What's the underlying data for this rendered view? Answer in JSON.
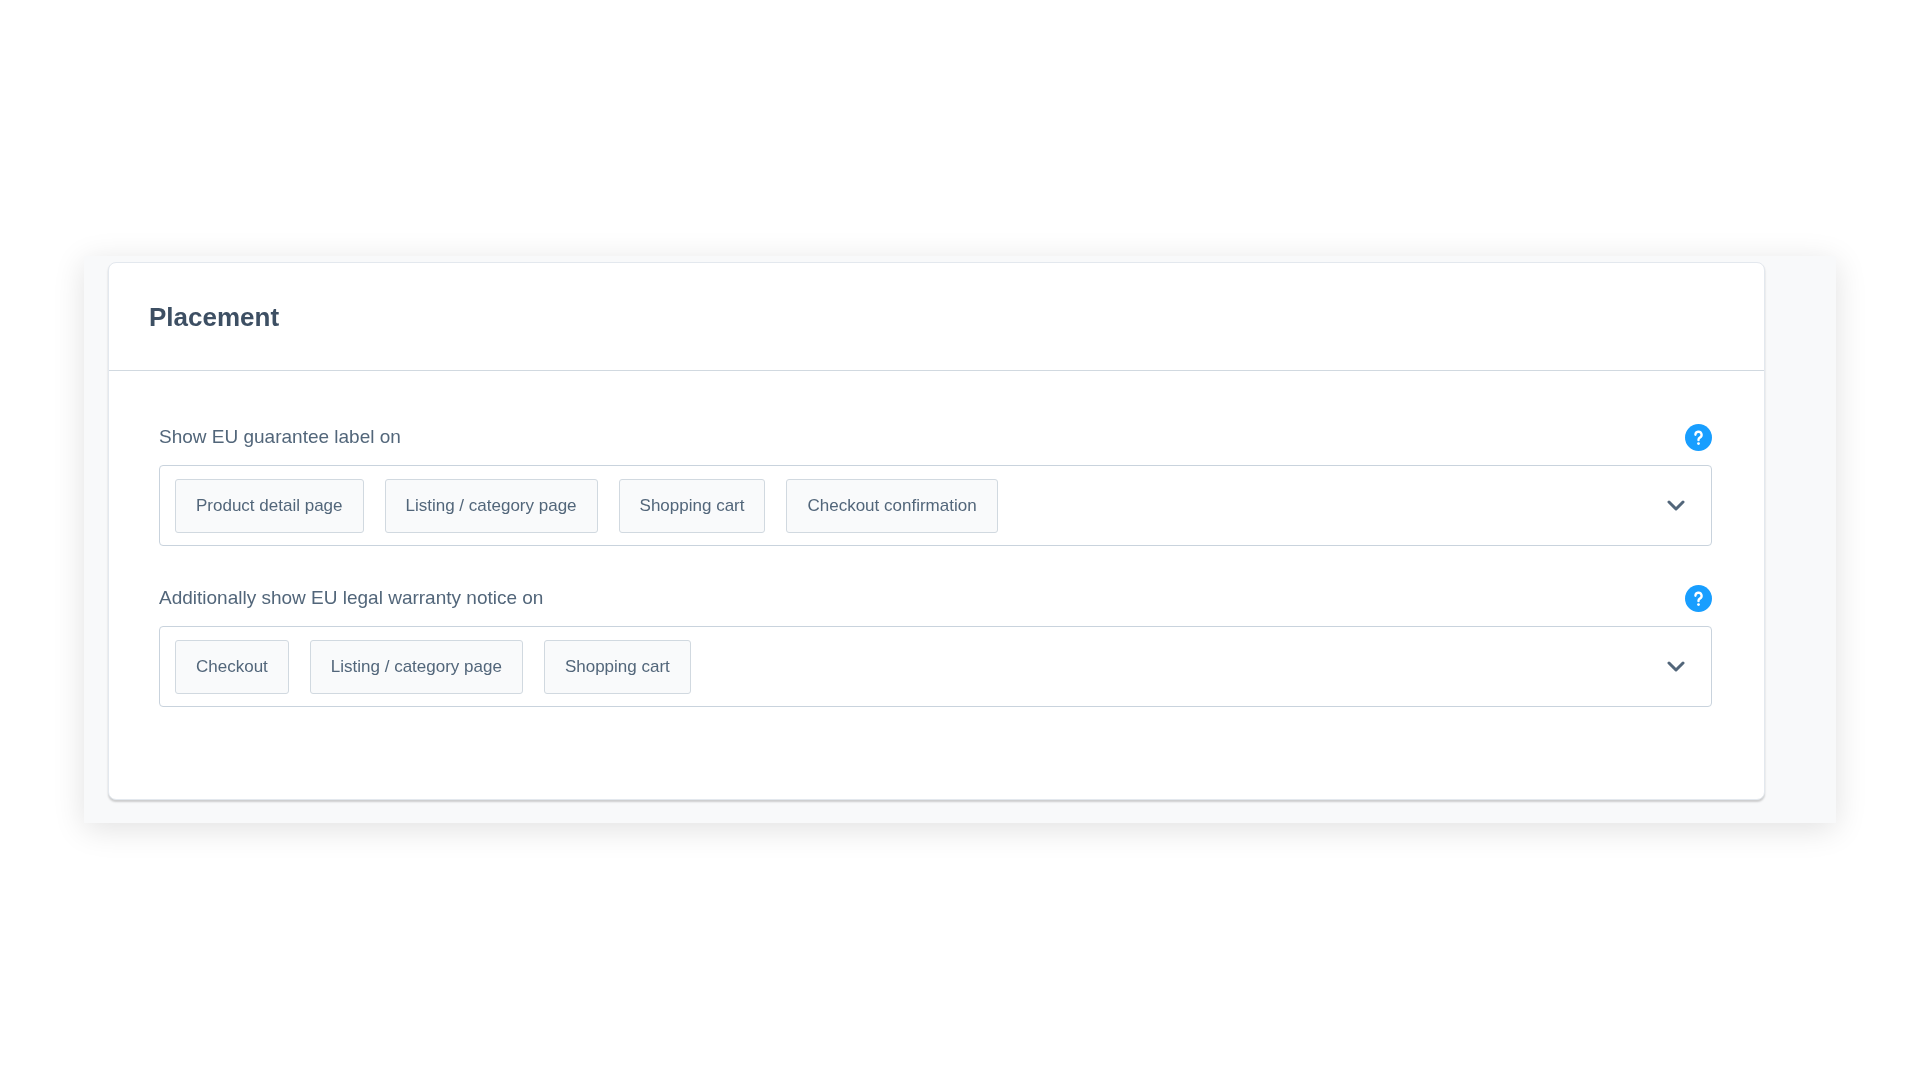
{
  "card": {
    "title": "Placement"
  },
  "fields": [
    {
      "label": "Show EU guarantee label on",
      "tags": [
        "Product detail page",
        "Listing / category page",
        "Shopping cart",
        "Checkout confirmation"
      ]
    },
    {
      "label": "Additionally show EU legal warranty notice on",
      "tags": [
        "Checkout",
        "Listing / category page",
        "Shopping cart"
      ]
    }
  ]
}
